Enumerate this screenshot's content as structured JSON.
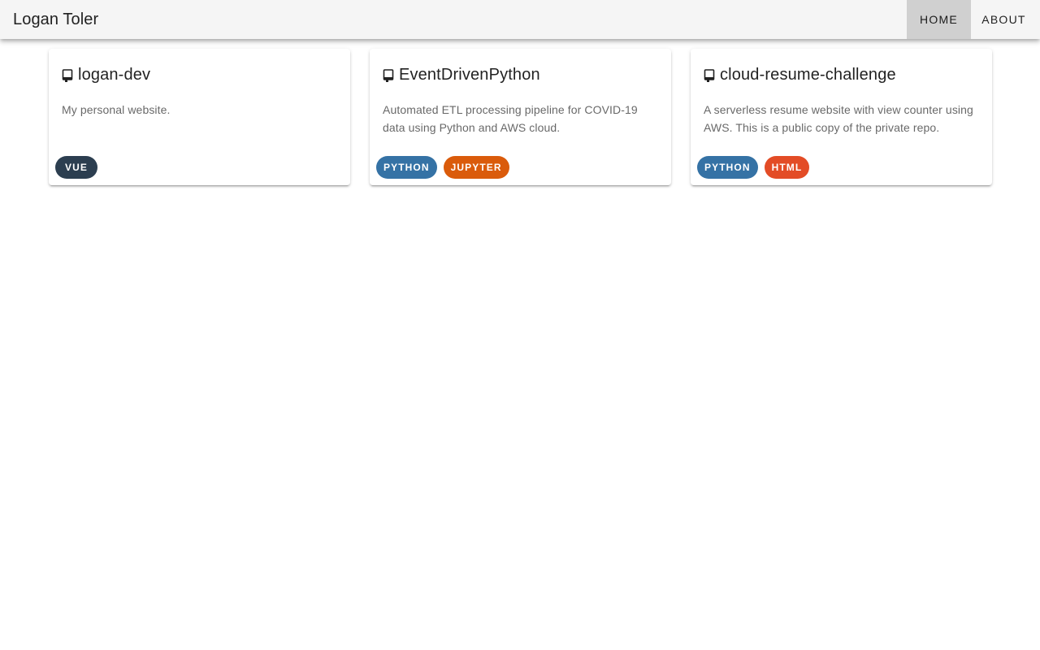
{
  "header": {
    "title": "Logan Toler",
    "nav": [
      {
        "label": "Home",
        "active": true
      },
      {
        "label": "About",
        "active": false
      }
    ]
  },
  "cards": [
    {
      "title": "logan-dev",
      "description": "My personal website.",
      "icon": "repo-icon",
      "tags": [
        {
          "label": "Vue",
          "color": "#2c3e50"
        }
      ]
    },
    {
      "title": "EventDrivenPython",
      "description": "Automated ETL processing pipeline for COVID-19 data using Python and AWS cloud.",
      "icon": "repo-icon",
      "tags": [
        {
          "label": "Python",
          "color": "#3572a5"
        },
        {
          "label": "Jupyter",
          "color": "#da5b0b"
        }
      ]
    },
    {
      "title": "cloud-resume-challenge",
      "description": "A serverless resume website with view counter using AWS. This is a public copy of the private repo.",
      "icon": "repo-icon",
      "tags": [
        {
          "label": "Python",
          "color": "#3572a5"
        },
        {
          "label": "HTML",
          "color": "#e34c26"
        }
      ]
    }
  ]
}
